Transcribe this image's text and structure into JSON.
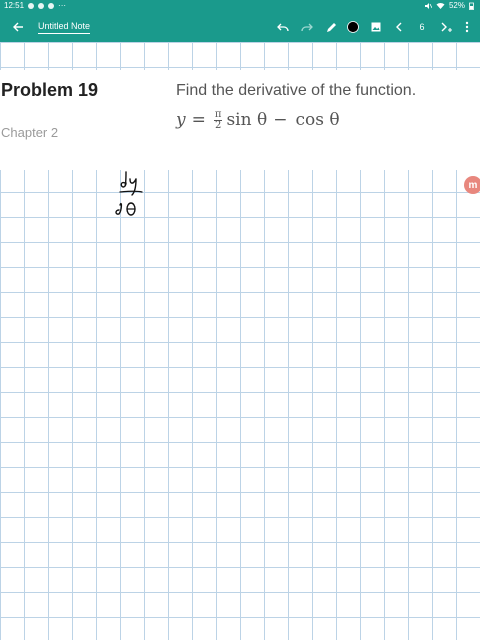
{
  "status_bar": {
    "time": "12:51",
    "more": "···",
    "battery": "52%"
  },
  "toolbar": {
    "note_title": "Untitled Note",
    "page_number": "6",
    "accent_color": "#1a9a8c",
    "icons": [
      "back-arrow-icon",
      "undo-icon",
      "redo-icon",
      "pen-icon",
      "color-dot-icon",
      "image-icon",
      "chevron-left-icon",
      "page-add-icon",
      "more-vert-icon"
    ]
  },
  "content": {
    "problem_title": "Problem 19",
    "chapter": "Chapter 2",
    "instruction": "Find the derivative of the function.",
    "equation": {
      "lhs": "y",
      "equals": "=",
      "frac_num": "π",
      "frac_den": "2",
      "term1": "sin θ",
      "minus": "−",
      "term2": "cos θ"
    }
  },
  "side_badge": {
    "label": "m",
    "color": "#e8877e"
  }
}
